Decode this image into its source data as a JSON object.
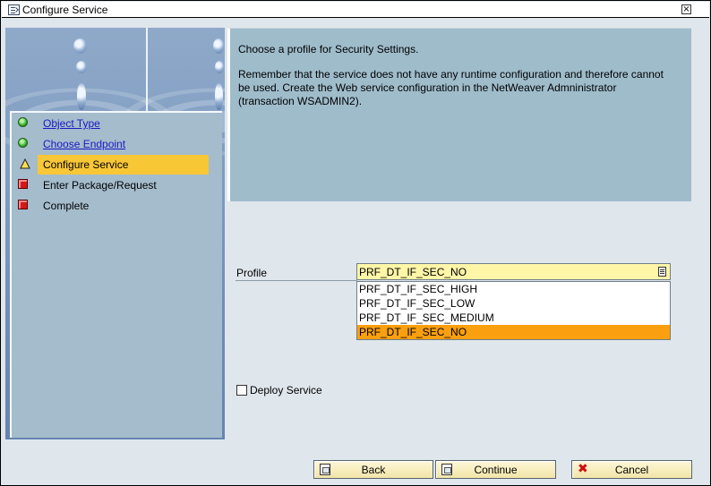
{
  "window": {
    "title": "Configure Service",
    "close_symbol": "×"
  },
  "steps": [
    {
      "label": "Object Type",
      "status": "complete",
      "icon": "green-dot-icon"
    },
    {
      "label": "Choose Endpoint",
      "status": "complete",
      "icon": "green-dot-icon"
    },
    {
      "label": "Configure Service",
      "status": "current",
      "icon": "warning-triangle-icon"
    },
    {
      "label": "Enter Package/Request",
      "status": "pending",
      "icon": "red-square-icon"
    },
    {
      "label": "Complete",
      "status": "pending",
      "icon": "red-square-icon"
    }
  ],
  "info": {
    "line1": "Choose a profile for Security Settings.",
    "line2": "Remember that the service does not have any runtime configuration and therefore cannot be used. Create the Web service configuration in the NetWeaver Admninistrator (transaction WSADMIN2)."
  },
  "profile": {
    "label": "Profile",
    "value": "PRF_DT_IF_SEC_NO",
    "options": [
      "PRF_DT_IF_SEC_HIGH",
      "PRF_DT_IF_SEC_LOW",
      "PRF_DT_IF_SEC_MEDIUM",
      "PRF_DT_IF_SEC_NO"
    ],
    "selected_index": 3
  },
  "deploy": {
    "label": "Deploy Service",
    "checked": false
  },
  "buttons": {
    "back": "Back",
    "continue": "Continue",
    "cancel": "Cancel"
  },
  "colors": {
    "highlight_step": "#f8c736",
    "selected_option": "#fa9f0f",
    "link": "#1a19c4",
    "combo_bg": "#fff6a8"
  }
}
